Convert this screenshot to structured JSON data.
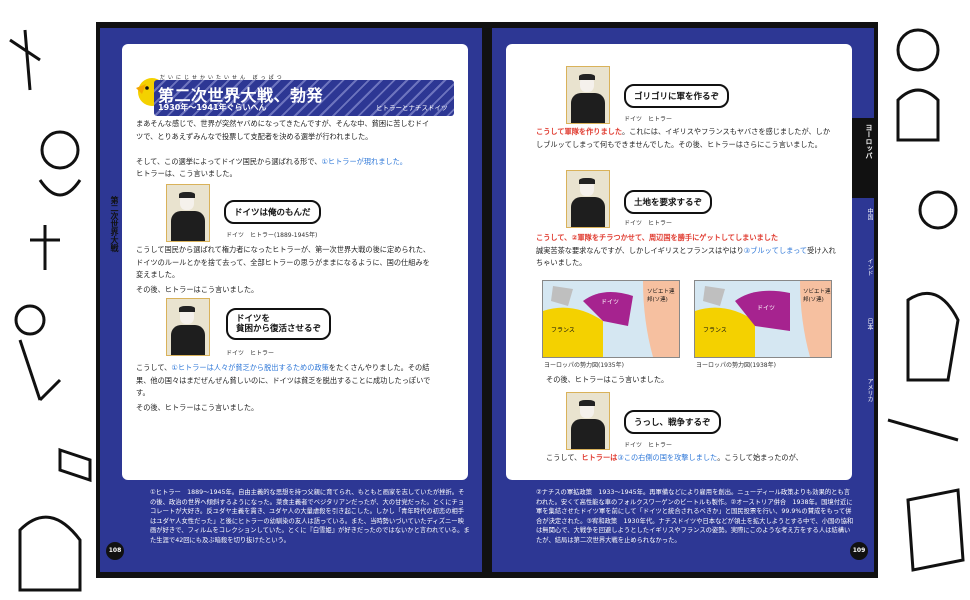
{
  "left_page": {
    "page_number": "108",
    "chapter_label": "第二次世界大戦",
    "title": {
      "main": "第二次世界大戦、勃発",
      "ruby": "だいにじせかいたいせん ぼっぱつ",
      "years": "1930年〜1941年ぐらいへん",
      "subtitle": "ヒトラーとナチスドイツ"
    },
    "paragraphs": [
      "まあそんな感じで、世界が突然ヤバめになってきたんですが、そんな中、貧困に苦しむドイツで、とりあえずみんなで投票して支配者を決める選挙が行われました。",
      "そして、この選挙によってドイツ国民から選ばれる形で、",
      "ヒトラーは、こう言いました。",
      "こうして国民から選ばれて権力者になったヒトラーが、第一次世界大戦の後に定められた、ドイツのルールとかを捨て去って、全部ヒトラーの思うがままになるように、国の仕組みを変えました。",
      "その後、ヒトラーはこう言いました。",
      "こうして、",
      "をたくさんやりました。その結果、他の国々はまだぜんぜん貧しいのに、ドイツは貧乏を脱出することに成功したっぽいです。",
      "その後、ヒトラーはこう言いました。"
    ],
    "highlights": {
      "hitler_elected": "①ヒトラーが現れました。",
      "policies": "①ヒトラーは人々が貧乏から脱出するための政策"
    },
    "bubbles": [
      "ドイツは俺のもんだ",
      "ドイツを\n貧困から復活させるぞ"
    ],
    "captions": [
      "ドイツ　ヒトラー(1889-1945年)",
      "ドイツ　ヒトラー"
    ],
    "notes": "①ヒトラー　1889〜1945年。自由主義的な思想を持つ父親に育てられ、もともと画家を志していたが挫折。その後、政治の世界へ傾斜するようになった。菜食主義者でベジタリアンだったが、大の甘党だった。とくにチョコレートが大好き。反ユダヤ主義を貫き、ユダヤ人の大量虐殺を引き起こした。しかし「青年時代の初恋の相手はユダヤ人女性だった」と後にヒトラーの幼馴染の友人は語っている。また、当時勢いづいていたディズニー映画が好きで、フィルムをコレクションしていた。とくに『白雪姫』が好きだったのではないかと言われている。また生涯で42回にも及ぶ暗殺を切り抜けたという。"
  },
  "right_page": {
    "page_number": "109",
    "tabs": [
      "ヨーロッパ",
      "中国",
      "インド",
      "日本",
      "アメリカ"
    ],
    "bubbles": [
      "ゴリゴリに軍を作るぞ",
      "土地を要求するぞ",
      "うっし、戦争するぞ"
    ],
    "captions": [
      "ドイツ　ヒトラー",
      "ドイツ　ヒトラー",
      "ドイツ　ヒトラー"
    ],
    "paragraphs": {
      "rearm_red": "こうして軍隊を作りました",
      "rearm_body": "。これには、イギリスやフランスもヤバさを感じましたが、しかしブルッてしまって何もできませんでした。その後、ヒトラーはさらにこう言いました。",
      "land_red": "こうして、②軍隊をチラつかせて、周辺国を勝手にゲットしてしまいました",
      "land_body": "誠実苦茶な要求なんですが、しかしイギリスとフランスはやはり",
      "land_blue": "③ブルッてしまって",
      "land_end": "受け入れちゃいました。",
      "after": "その後、ヒトラーはこう言いました。",
      "war_pre": "こうして、",
      "war_red": "ヒトラーは",
      "war_blue": "③この右側の国を攻撃しました",
      "war_end": "。こうして始まったのが、"
    },
    "maps": [
      {
        "caption": "ヨーロッパの勢力図(1935年)",
        "labels": [
          "ドイツ",
          "フランス",
          "ソビエト連邦(ソ連)"
        ]
      },
      {
        "caption": "ヨーロッパの勢力図(1938年)",
        "labels": [
          "ドイツ",
          "フランス",
          "ソビエト連邦(ソ連)"
        ]
      }
    ],
    "notes": "②ナチスの軍拡政策　1933〜1945年。再軍備などにより雇用を創出。ニューディール政策よりも効果的とも言われた。安くて高性能な車のフォルクスワーゲンのビートルも製作。②オーストリア併合　1938年。国境付近に軍を集結させたドイツ軍を前にして「ドイツと統合されるべきか」と国民投票を行い、99.9%の賛成をもって併合が決定された。③宥和政策　1930年代。ナチスドイツや日本などが領土を拡大しようとする中で、小国の協和は無関心で、大戦争を回避しようとしたイギリスやフランスの姿勢。実際にこのような考え方をする人は結構いたが、結局は第二次世界大戦を止められなかった。"
  },
  "colors": {
    "navy": "#2d3794",
    "red": "#e03c31",
    "blue": "#2f78d8",
    "germany": "#a6238f",
    "france": "#f4d100"
  }
}
